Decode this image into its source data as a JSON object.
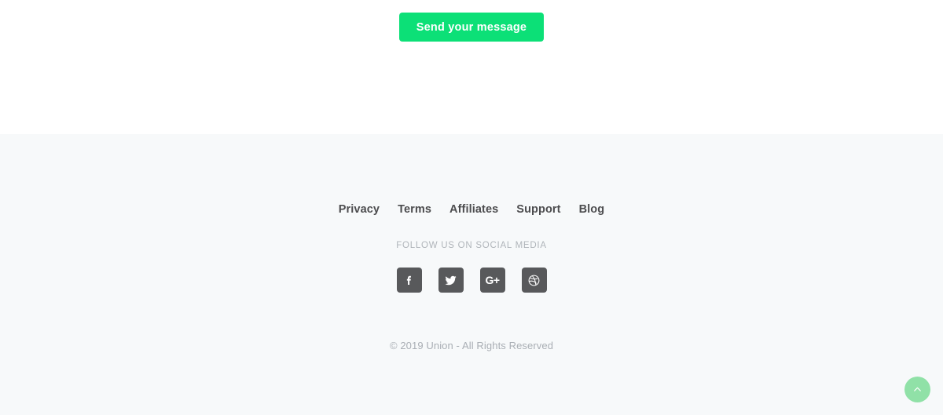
{
  "cta": {
    "label": "Send your message",
    "color": "#0ce077",
    "text_color": "#ffffff"
  },
  "footer": {
    "background": "#f7f9fa",
    "nav": [
      {
        "label": "Privacy"
      },
      {
        "label": "Terms"
      },
      {
        "label": "Affiliates"
      },
      {
        "label": "Support"
      },
      {
        "label": "Blog"
      }
    ],
    "nav_color": "#4c4c4e",
    "follow_label": "FOLLOW US ON SOCIAL MEDIA",
    "follow_color": "#b0b5ba",
    "social": [
      {
        "name": "Facebook",
        "icon": "facebook-icon",
        "glyph": "f"
      },
      {
        "name": "Twitter",
        "icon": "twitter-icon",
        "glyph": ""
      },
      {
        "name": "Google Plus",
        "icon": "google-plus-icon",
        "glyph": "G+"
      },
      {
        "name": "Dribbble",
        "icon": "dribbble-icon",
        "glyph": ""
      }
    ],
    "social_button_color": "#58595b",
    "copyright": "© 2019 Union - All Rights Reserved",
    "copyright_color": "#a9aeb4"
  },
  "scroll_top": {
    "icon": "chevron-up-icon",
    "color": "#90e1a7"
  }
}
